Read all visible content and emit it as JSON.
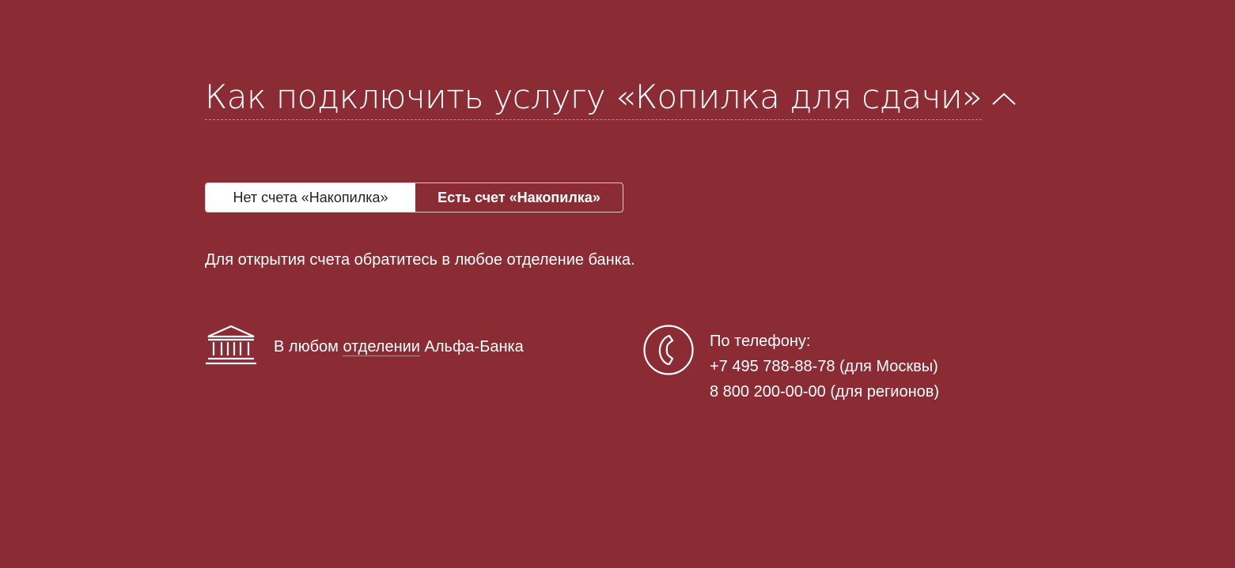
{
  "heading": {
    "title": "Как подключить услугу «Копилка для сдачи»",
    "toggle_icon": "chevron-up-icon"
  },
  "tabs": [
    {
      "label": "Нет счета «Накопилка»",
      "active": true
    },
    {
      "label": "Есть счет «Накопилка»",
      "active": false
    }
  ],
  "description": "Для открытия счета обратитесь в любое отделение банка.",
  "branch": {
    "icon": "bank-building-icon",
    "prefix": "В любом",
    "link_text": "отделении",
    "suffix": "Альфа-Банка"
  },
  "phone": {
    "icon": "phone-icon",
    "label": "По телефону:",
    "moscow": "+7 495 788-88-78 (для Москвы)",
    "regions": "8 800 200-00-00 (для регионов)"
  },
  "colors": {
    "background": "#8b2c35",
    "text": "#ffffff",
    "active_tab_bg": "#ffffff",
    "active_tab_text": "#222222"
  }
}
